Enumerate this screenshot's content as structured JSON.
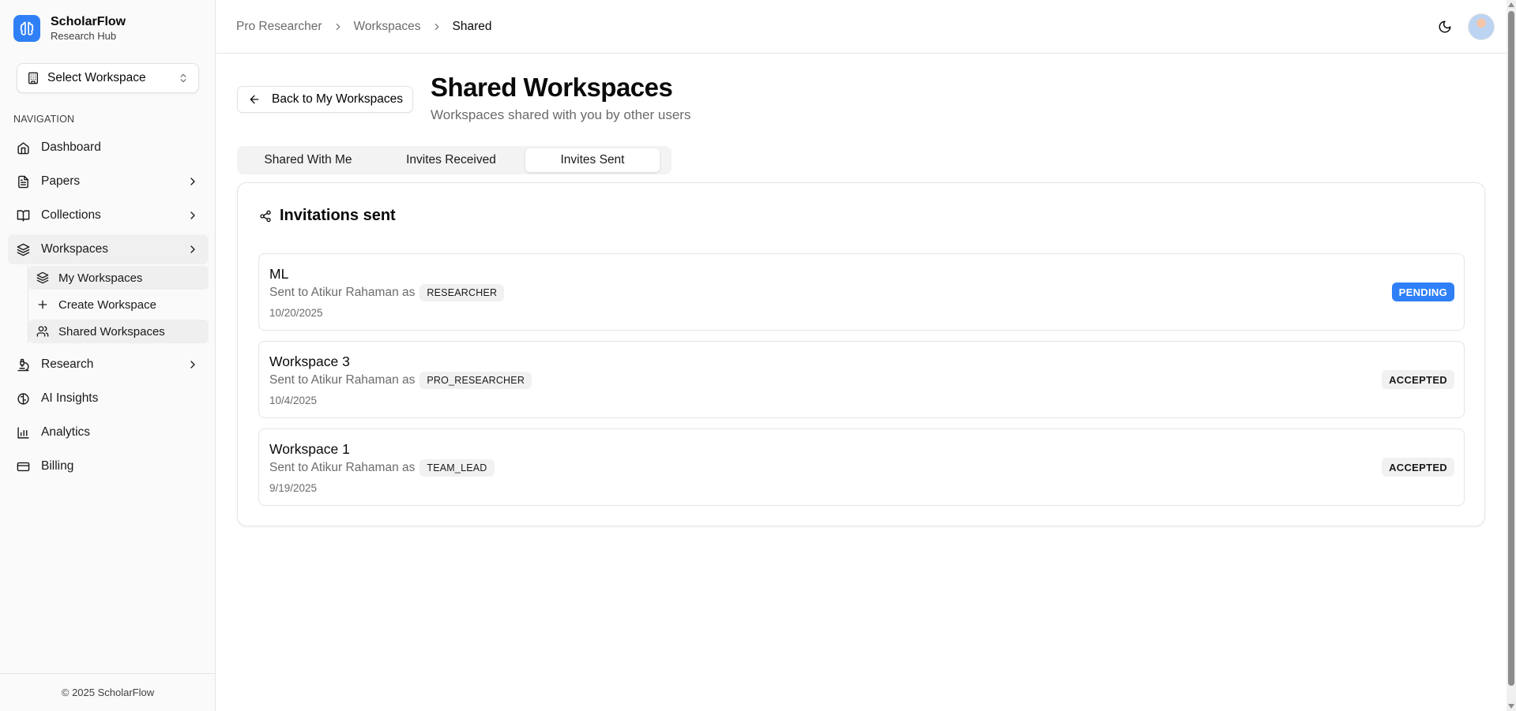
{
  "brand": {
    "name": "ScholarFlow",
    "subtitle": "Research Hub"
  },
  "workspace_select": {
    "label": "Select Workspace"
  },
  "nav": {
    "heading": "NAVIGATION",
    "items": {
      "dashboard": "Dashboard",
      "papers": "Papers",
      "collections": "Collections",
      "workspaces": "Workspaces",
      "research": "Research",
      "ai_insights": "AI Insights",
      "analytics": "Analytics",
      "billing": "Billing"
    },
    "workspace_sub": {
      "my": "My Workspaces",
      "create": "Create Workspace",
      "shared": "Shared Workspaces"
    }
  },
  "footer": {
    "copyright": "© 2025 ScholarFlow"
  },
  "breadcrumb": [
    "Pro Researcher",
    "Workspaces",
    "Shared"
  ],
  "main": {
    "back_label": "Back to My Workspaces",
    "title": "Shared Workspaces",
    "subtitle": "Workspaces shared with you by other users",
    "tabs": [
      "Shared With Me",
      "Invites Received",
      "Invites Sent"
    ],
    "active_tab": "Invites Sent",
    "card_title": "Invitations sent",
    "sent_to_prefix": "Sent to Atikur Rahaman as",
    "invites": [
      {
        "name": "ML",
        "role": "RESEARCHER",
        "date": "10/20/2025",
        "status": "PENDING"
      },
      {
        "name": "Workspace 3",
        "role": "PRO_RESEARCHER",
        "date": "10/4/2025",
        "status": "ACCEPTED"
      },
      {
        "name": "Workspace 1",
        "role": "TEAM_LEAD",
        "date": "9/19/2025",
        "status": "ACCEPTED"
      }
    ]
  },
  "colors": {
    "accent": "#2f80f6",
    "muted_text": "#6b6b6b",
    "border": "#e5e5e5"
  }
}
